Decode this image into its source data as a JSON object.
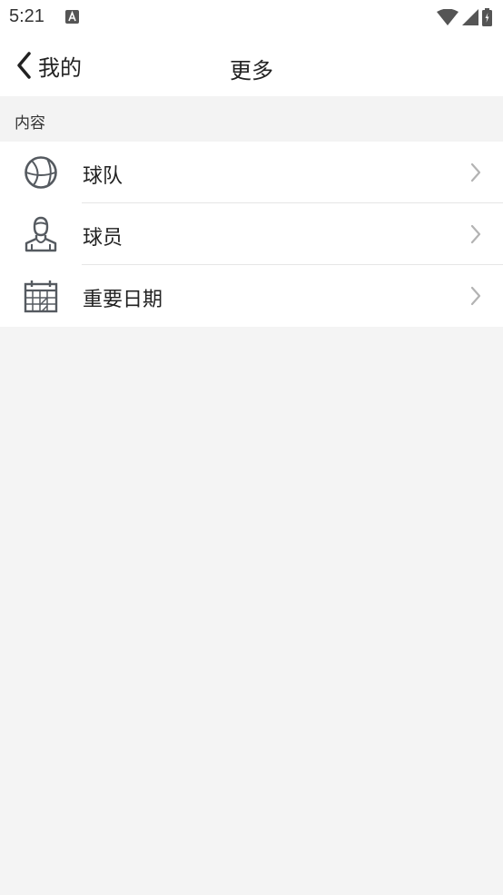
{
  "status_bar": {
    "time": "5:21",
    "icons": [
      "a-icon",
      "wifi-icon",
      "signal-icon",
      "battery-icon"
    ]
  },
  "header": {
    "back_label": "我的",
    "title": "更多"
  },
  "section": {
    "title": "内容"
  },
  "items": [
    {
      "label": "球队",
      "icon": "basketball-icon"
    },
    {
      "label": "球员",
      "icon": "player-icon"
    },
    {
      "label": "重要日期",
      "icon": "calendar-icon"
    }
  ],
  "colors": {
    "background": "#f4f4f4",
    "surface": "#ffffff",
    "icon": "#555a60",
    "chevron": "#b3b3b3"
  }
}
